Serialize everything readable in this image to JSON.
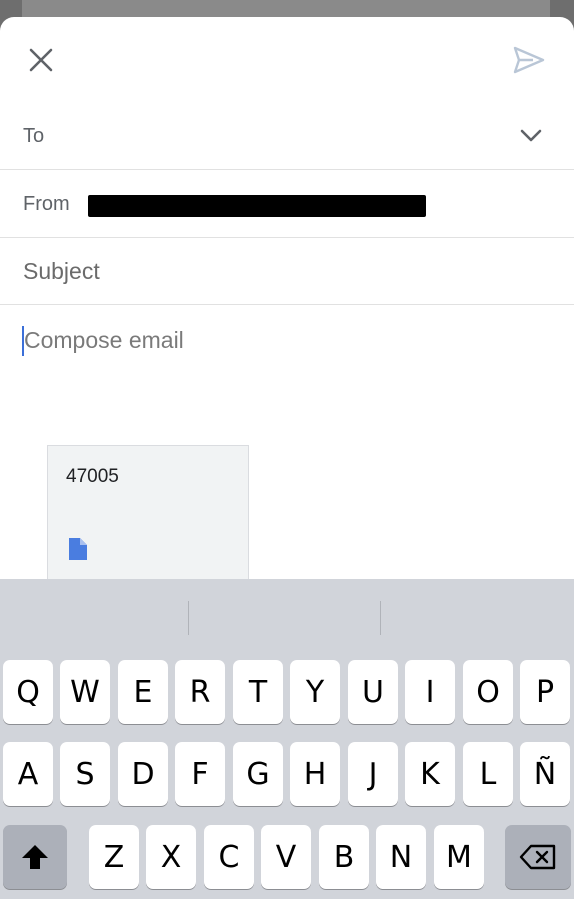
{
  "header": {
    "close_icon": "close-icon",
    "send_icon": "send-icon"
  },
  "fields": {
    "to_label": "To",
    "from_label": "From",
    "subject_placeholder": "Subject",
    "chevron_icon": "chevron-down-icon"
  },
  "compose": {
    "body_placeholder": "Compose email"
  },
  "attachment": {
    "name": "47005",
    "icon": "file-icon",
    "icon_color": "#4a7de0"
  },
  "keyboard": {
    "row1": [
      "Q",
      "W",
      "E",
      "R",
      "T",
      "Y",
      "U",
      "I",
      "O",
      "P"
    ],
    "row2": [
      "A",
      "S",
      "D",
      "F",
      "G",
      "H",
      "J",
      "K",
      "L",
      "Ñ"
    ],
    "row3": [
      "Z",
      "X",
      "C",
      "V",
      "B",
      "N",
      "M"
    ],
    "shift_icon": "shift-icon",
    "backspace_icon": "backspace-icon"
  },
  "colors": {
    "accent": "#3b6fd8",
    "keyboard_bg": "#d1d4da",
    "key_bg": "#ffffff"
  }
}
